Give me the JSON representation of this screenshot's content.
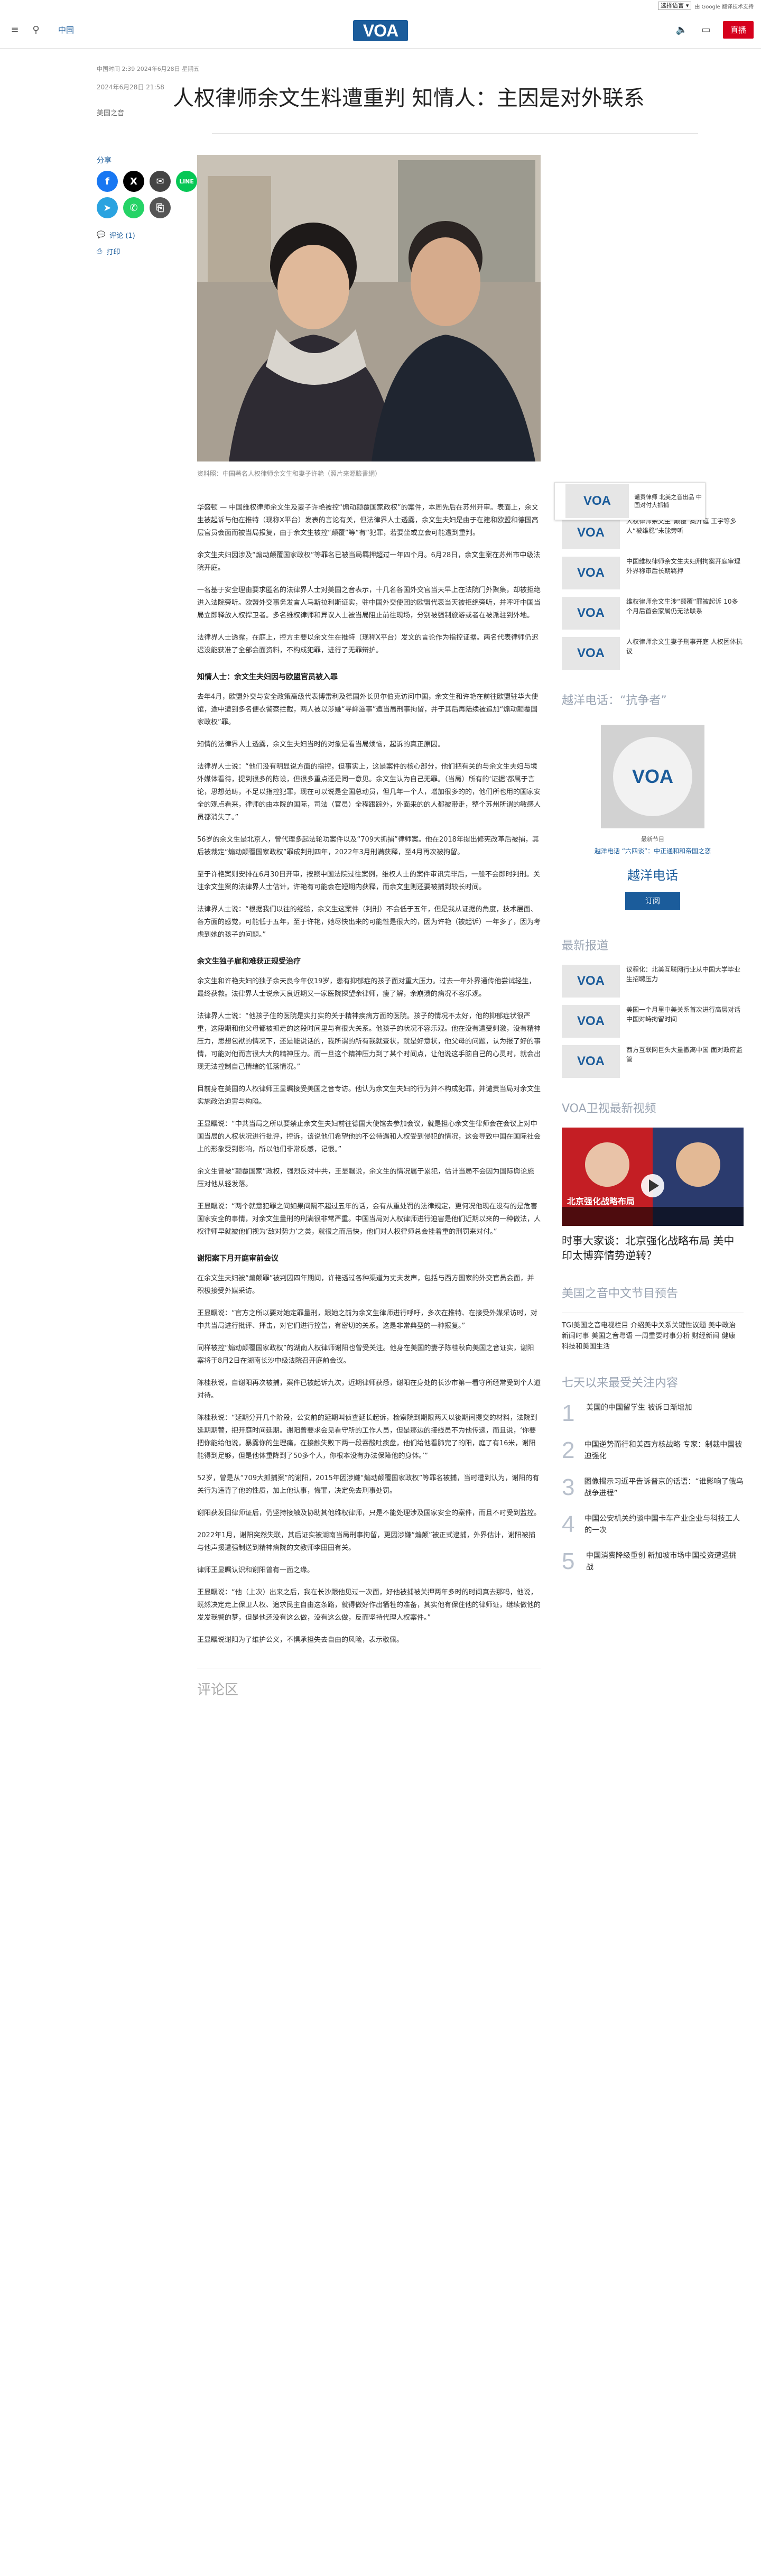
{
  "topbar": {
    "language_select": "选择语言",
    "translate_label": "由 Google 翻译技术支持"
  },
  "header": {
    "category": "中国",
    "logo": "VOA",
    "live_label": "直播"
  },
  "article": {
    "dateline": "中国时间 2:39 2024年6月28日 星期五",
    "date": "2024年6月28日 21:58",
    "author": "美国之音",
    "title": "人权律师余文生料遭重判 知情人：主因是对外联系",
    "photo_caption": "资料照：中国著名人权律师余文生和妻子许艳（照片来源臉書網）",
    "paragraphs_1": [
      "华盛顿 — 中国维权律师余文生及妻子许艳被控“煽动颠覆国家政权”的案件，本周先后在苏州开审。表面上，余文生被起诉与他在推特（现称X平台）发表的言论有关，但法律界人士透露，余文生夫妇是由于在建和欧盟和德国高层官员会面而被当局报复，由于余文生被控“颠覆”等“有”犯罪，若要坐或立会可能遭到重判。",
      "余文生夫妇因涉及“煽动颠覆国家政权”等罪名已被当局羁押超过一年四个月。6月28日，余文生案在苏州市中级法院开庭。",
      "一名基于安全理由要求匿名的法律界人士对美国之音表示，十几名各国外交官当天早上在法院门外聚集，却被拒绝进入法院旁听。欧盟外交事务发言人马斯拉利斯证实，驻中国外交使团的欧盟代表当天被拒绝旁听，并呼吁中国当局立即释放人权捍卫者。多名维权律师和异议人士被当局阻止前往现场，分别被强制旅游或者在被派驻到外地。",
      "法律界人士透露，在庭上，控方主要以余文生在推特（现称X平台）发文的言论作为指控证据。两名代表律师仍迟迟没能获准了全部会面资料，不构成犯罪，进行了无罪辩护。"
    ],
    "h_1": "知情人士：余文生夫妇因与欧盟官员被入罪",
    "paragraphs_2": [
      "去年4月，欧盟外交与安全政策高级代表博雷利及德国外长贝尔伯克访问中国，余文生和许艳在前往欧盟驻华大使馆，途中遭到多名便衣警察拦截，两人被以涉嫌“寻衅滋事”遭当局刑事拘留，并于其后再陆续被追加“煽动颠覆国家政权”罪。",
      "知情的法律界人士透露，余文生夫妇当时的对象是看当局烦恼，起诉的真正原因。",
      "法律界人士说：“他们没有明显说方面的指控，但事实上，这是案件的核心部分，他们把有关的与余文生夫妇与境外媒体看待，提到很多的陈设，但很多重点还是同一意见。余文生认为自己无罪。（当局）所有的‘证据’都属于言论，思想范畴，不足以指控犯罪，现在可以说是全国总动员，但几年一个人，增加很多的的，他们所也用的国家安全的观点看来，律师的由本院的国际，司法（官员）全程跟踪外，外面来的的人都被带走，整个苏州所谓的敏感人员都消失了。”",
      "56岁的余文生是北京人，曾代理多起法轮功案件以及“709大抓捕”律师案。他在2018年提出修宪改革后被捕，其后被裁定“煽动颠覆国家政权”罪成判刑四年，2022年3月刑满获释，至4月再次被拘留。",
      "至于许艳案则安排在6月30日开审，按照中国法院过往案例，维权人士的案件审讯完毕后，一般不会即时判刑。关注余文生案的法律界人士估计，许艳有可能会在短期内获释，而余文生则还要被捕到较长时间。",
      "法律界人士说：“根据我们以往的经验，余文生这案件（判刑）不会低于五年，但是我从证据的角度，技术层面、各方面的感觉，可能低于五年，至于许艳，她尽快出来的可能性是很大的，因为许艳（被起诉）一年多了，因为考虑到她的孩子的问题。”"
    ],
    "h_2": "余文生独子雇和难获正规受治疗",
    "paragraphs_3": [
      "余文生和许艳夫妇的独子余天良今年仅19岁，患有抑郁症的孩子面对重大压力。过去一年外界通传他尝试轻生，最终获救。法律界人士说余天良近期又一家医院探望余律师，瘦了解，余崩溃的病况不容乐观。",
      "法律界人士说：“他孩子住的医院是实打实的关于精神疾病方面的医院。孩子的情况不太好，他的抑郁症状很严重，这段期和他父母都被抓走的这段时间里与有很大关系。他孩子的状况不容乐观。他在没有遭受刺激，没有精神压力，思想包袱的情况下，还是能说话的，我所谓的所有我就查状，就是好意状，他父母的问题，认为报了好的事情，可能对他而言很大大的精神压力。而一旦这个精神压力到了某个时间点，让他说这手脑自己的心灵时，就会出现无法控制自己情绪的低落情况。”",
      "目前身在美国的人权律师王显瞩接受美国之音专访。他认为余文生夫妇的行为并不构成犯罪，并谴责当局对余文生实施政治迫害与构陷。",
      "王显瞩说：“中共当局之所以要禁止余文生夫妇前往德国大使馆去参加会议，就是担心余文生律师会在会议上对中国当局的人权状况进行批评，控诉，该说他们希望他的不公待遇和人权受到侵犯的情况，这会导致中国在国际社会上的形象受到影响，所以他们非常反感，记恨。”",
      "余文生曾被“颠覆国家”政权，强烈反对中共，王显瞩说，余文生的情况属于累犯，估计当局不会因为国际舆论施压对他从轻发落。",
      "王显瞩说：“两个就意犯罪之间如果间隔不超过五年的话，会有从重处罚的法律规定，更何况他现在没有的是危害国家安全的事情，对余文生量刑的刑满很非常严重。中国当局对人权律师进行迫害是他们近期以来的一种做法，人权律师早就被他们视为‘敌对势力’之类，就很之而后快，他们对人权律师总会挂着重的刑罚来对付。”"
    ],
    "h_3": "谢阳案下月开庭审前会议",
    "paragraphs_4": [
      "在余文生夫妇被“煽颠罪”被判囚四年期间，许艳透过各种渠道为丈夫发声，包括与西方国家的外交官员会面，并积极接受外媒采访。",
      "王显瞩说：“官方之所以要对她定罪量刑，跟她之前为余文生律师进行呼吁，多次在推特、在接受外媒采访时，对中共当局进行批评、抨击，对它们进行控告，有密切的关系。这是非常典型的一种报复。”",
      "同样被控“煽动颠覆国家政权”的湖南人权律师谢阳也曾受关注。他身在美国的妻子陈桂秋向美国之音证实，谢阳案将于8月2日在湖南长沙中级法院召开庭前会议。",
      "陈桂秋说，自谢阳再次被捕，案件已被起诉九次，近期律师获悉，谢阳在身处的长沙市第一看守所经常受到个人道对待。",
      "陈桂秋说：“延期分开几个阶段，公安前的延期叫侦查延长起诉，检察院到期限两天以後期间提交的材料，法院到延期期替，把开庭时间延期。谢阳曾要求会见看守所的工作人员，但是那边的接线员不为他传递，而且说，‘你要把你能给他说，暴露你的生理痛，在接触失败下两一段吞酸吐痰盘，他们给他看肺完了的阳，庭了有16米，谢阳能得到足够，但是他体重降到了50多个人，你根本没有办法保障他的身体。’”",
      "52岁，曾是从“709大抓捕案”的谢阳，2015年因涉嫌“煽动颠覆国家政权”等罪名被捕，当时遭到认为，谢阳的有关行为违背了他的性质，加上他认事，悔罪，决定免去刑事处罚。",
      "谢阳获发回律师证后，仍坚持接触及协助其他维权律师，只是不能处理涉及国家安全的案件，而且不时受到监控。",
      "2022年1月，谢阳突然失联，其后证实被湖南当局刑事拘留，更因涉嫌“煽颠”被正式逮捕，外界估计，谢阳被捕与他声援遭强制送到精神病院的文教师李田田有关。",
      "律师王显瞩认识和谢阳曾有一面之缘。",
      "王显瞩说：“他（上次）出来之后，我在长沙跟他见过一次面，好他被捕被关押两年多时的时间真去那吗，他说，既然决定走上保卫人权、追求民主自由这条路，就得做好作出牺牲的准备，其实他有保住他的律师证，继续做他的发发我警的梦，但是他还没有这么做，没有这么做，反而坚持代理人权案件。”",
      "王显瞩说谢阳为了维护公义，不惧承担失去自由的风险，表示敬佩。"
    ],
    "comments_label": "评论区"
  },
  "share": {
    "label": "分享",
    "comments_link": "评论 (1)",
    "print_link": "打印"
  },
  "related": {
    "heading": "相关内容",
    "items": [
      "人权律师余文生“颠覆”案开庭 王宇等多人“被维稳”未能旁听",
      "中国维权律师余文生夫妇刑拘案开庭审理 外界称审后长期羁押",
      "维权律师余文生涉“颠覆”罪被起诉 10多个月后首会家属仍无法联系",
      "人权律师余文生妻子刑事开庭 人权团体抗议"
    ]
  },
  "podcast": {
    "heading": "越洋电话：“抗争者”",
    "small": "最新节目",
    "links": "越洋电话 “六四谈”：中正通和和帝国之恋",
    "title": "越洋电话",
    "subscribe": "订阅"
  },
  "latest": {
    "heading": "最新报道",
    "items": [
      "议程化：北美互联网行业从中国大学毕业生招聘压力",
      "美国一个月里中美关系首次进行高层对话 中国对峙拘留时间",
      "西方互联网巨头大量撤离中国 面对政府监管"
    ]
  },
  "video": {
    "heading": "VOA卫视最新视频",
    "overlay": "北京强化战略布局",
    "title": "时事大家谈：北京强化战略布局 美中印太博弈情势逆转？"
  },
  "schedule": {
    "heading": "美国之音中文节目预告",
    "text": "TGI美国之音电视栏目 介绍美中关系关键性议题 美中政治 新闻时事 美国之音粤语 一周重要时事分析 财经新闻 健康 科技和美国生活"
  },
  "ranking": {
    "heading": "七天以来最受关注内容",
    "items": [
      {
        "num": "1",
        "text": "美国的中国留学生 被诉日渐增加"
      },
      {
        "num": "2",
        "text": "中国逆势而行和美西方核战略 专家：制裁中国被迫强化"
      },
      {
        "num": "3",
        "text": "图像揭示习近平告诉普京的话语：“谁影响了俄乌战争进程”"
      },
      {
        "num": "4",
        "text": "中国公安机关约谈中国卡车产业企业与科技工人的一次"
      },
      {
        "num": "5",
        "text": "中国消费降级重创 新加坡市场中国投资遭遇挑战"
      }
    ]
  },
  "sticky": {
    "text": "谴责律师 北美之音出品 中国对付大抓捕"
  },
  "colors": {
    "brand": "#1b5c9b",
    "live": "#d6001c",
    "facebook": "#1877f2",
    "x": "#000000",
    "email": "#444444",
    "line": "#06c755",
    "telegram": "#2aa3e0",
    "whatsapp": "#25d366",
    "copy": "#555555"
  }
}
